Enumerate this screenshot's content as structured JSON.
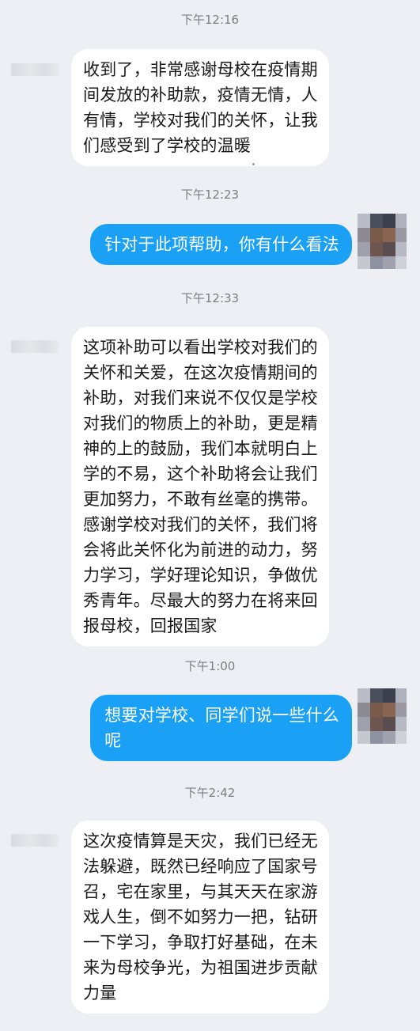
{
  "messages": [
    {
      "time": "下午12:16",
      "direction": "in",
      "lines": [
        "收到了，非常感谢母校在疫情期",
        "间发放的补助款，疫情无情，人",
        "有情，学校对我们的关怀，让我",
        "们感受到了学校的温暖"
      ]
    },
    {
      "time": "下午12:23",
      "direction": "out",
      "lines": [
        "针对于此项帮助，你有什么看法"
      ]
    },
    {
      "time": "下午12:33",
      "direction": "in",
      "lines": [
        "这项补助可以看出学校对我们的",
        "关怀和关爱，在这次疫情期间的",
        "补助，对我们来说不仅仅是学校",
        "对我们的物质上的补助，更是精",
        "神的上的鼓励，我们本就明白上",
        "学的不易，这个补助将会让我们",
        "更加努力，不敢有丝毫的携带。",
        "感谢学校对我们的关怀，我们将",
        "会将此关怀化为前进的动力，努",
        "力学习，学好理论知识，争做优",
        "秀青年。尽最大的努力在将来回",
        "报母校，回报国家"
      ]
    },
    {
      "time": "下午1:00",
      "direction": "out",
      "lines": [
        "想要对学校、同学们说一些什么",
        "呢"
      ]
    },
    {
      "time": "下午2:42",
      "direction": "in",
      "lines": [
        "这次疫情算是天灾，我们已经无",
        "法躲避，既然已经响应了国家号",
        "召，宅在家里，与其天天在家游",
        "戏人生，倒不如努力一把，钻研",
        "一下学习，争取打好基础，在未",
        "来为母校争光，为祖国进步贡献",
        "力量"
      ]
    }
  ],
  "colors": {
    "background": "#eeeff4",
    "outgoing_bubble": "#1aa1f6",
    "incoming_bubble": "#ffffff",
    "timestamp": "#7b7d82"
  }
}
